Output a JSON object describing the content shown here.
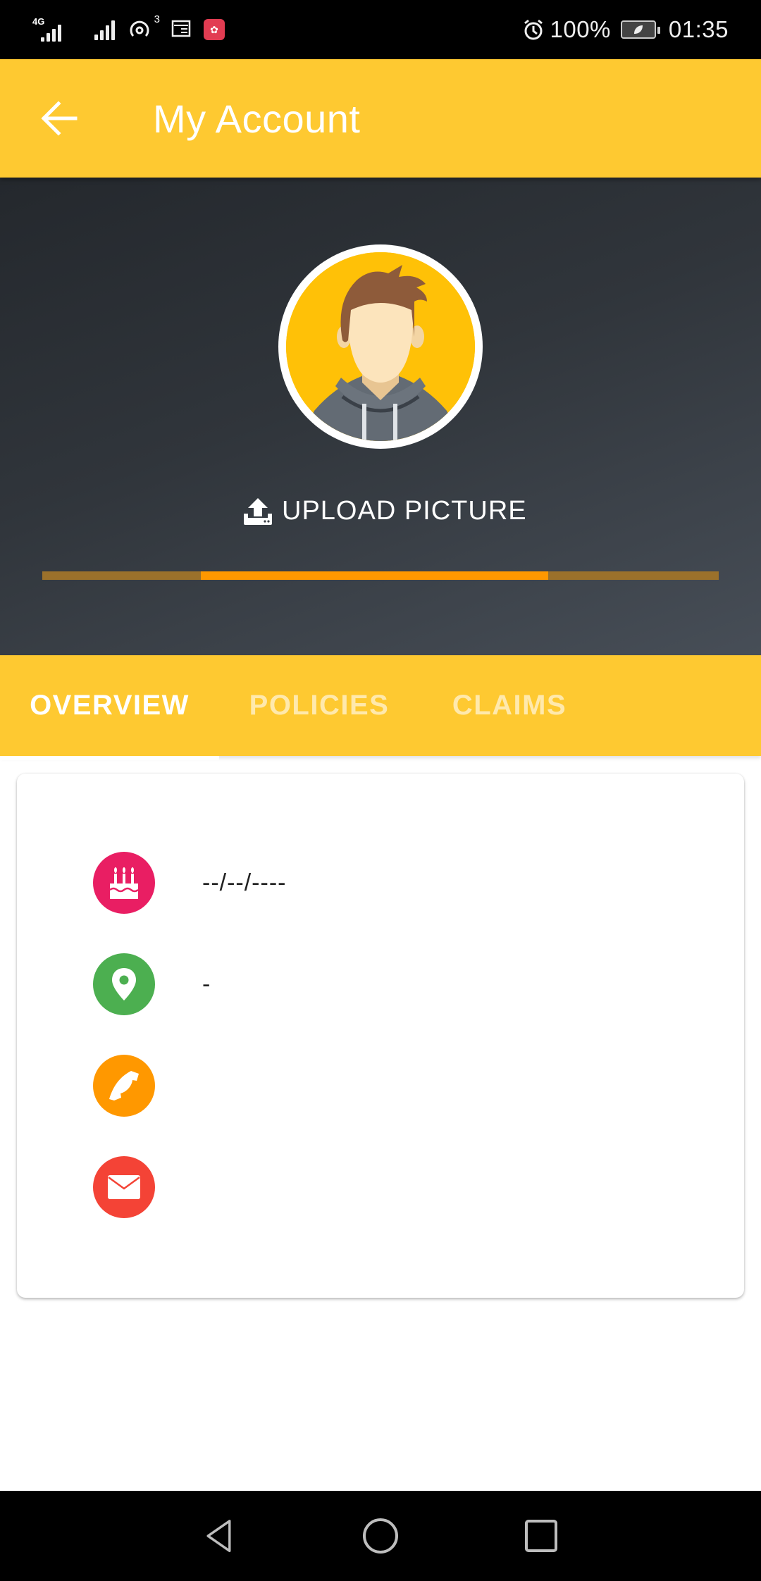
{
  "status_bar": {
    "network_type": "4G",
    "hotspot_count": "3",
    "battery_percent": "100%",
    "time": "01:35",
    "icons": [
      "signal-4g-icon",
      "signal-icon",
      "hotspot-icon",
      "news-icon",
      "huawei-app-icon",
      "alarm-icon",
      "battery-saver-icon"
    ]
  },
  "app_bar": {
    "title": "My Account",
    "back_icon": "arrow-left-icon"
  },
  "profile": {
    "avatar_alt": "default avatar",
    "upload_label": "UPLOAD PICTURE",
    "upload_icon": "upload-icon",
    "progress": {
      "state": "indeterminate",
      "active_segment_start": 0.234,
      "active_segment_end": 0.748
    }
  },
  "tabs": [
    {
      "label": "OVERVIEW",
      "active": true
    },
    {
      "label": "POLICIES",
      "active": false
    },
    {
      "label": "CLAIMS",
      "active": false
    }
  ],
  "overview": {
    "rows": [
      {
        "icon": "birthday-cake-icon",
        "color": "#E91E63",
        "value": "--/--/----"
      },
      {
        "icon": "location-pin-icon",
        "color": "#4CAF50",
        "value": "-"
      },
      {
        "icon": "phone-icon",
        "color": "#FF9800",
        "value": ""
      },
      {
        "icon": "email-icon",
        "color": "#F44336",
        "value": ""
      }
    ]
  },
  "colors": {
    "primary": "#FEC931",
    "accent": "#FF9800",
    "hero_dark": "#2C3136"
  },
  "nav_bar": {
    "buttons": [
      "back-nav",
      "home-nav",
      "recents-nav"
    ]
  }
}
